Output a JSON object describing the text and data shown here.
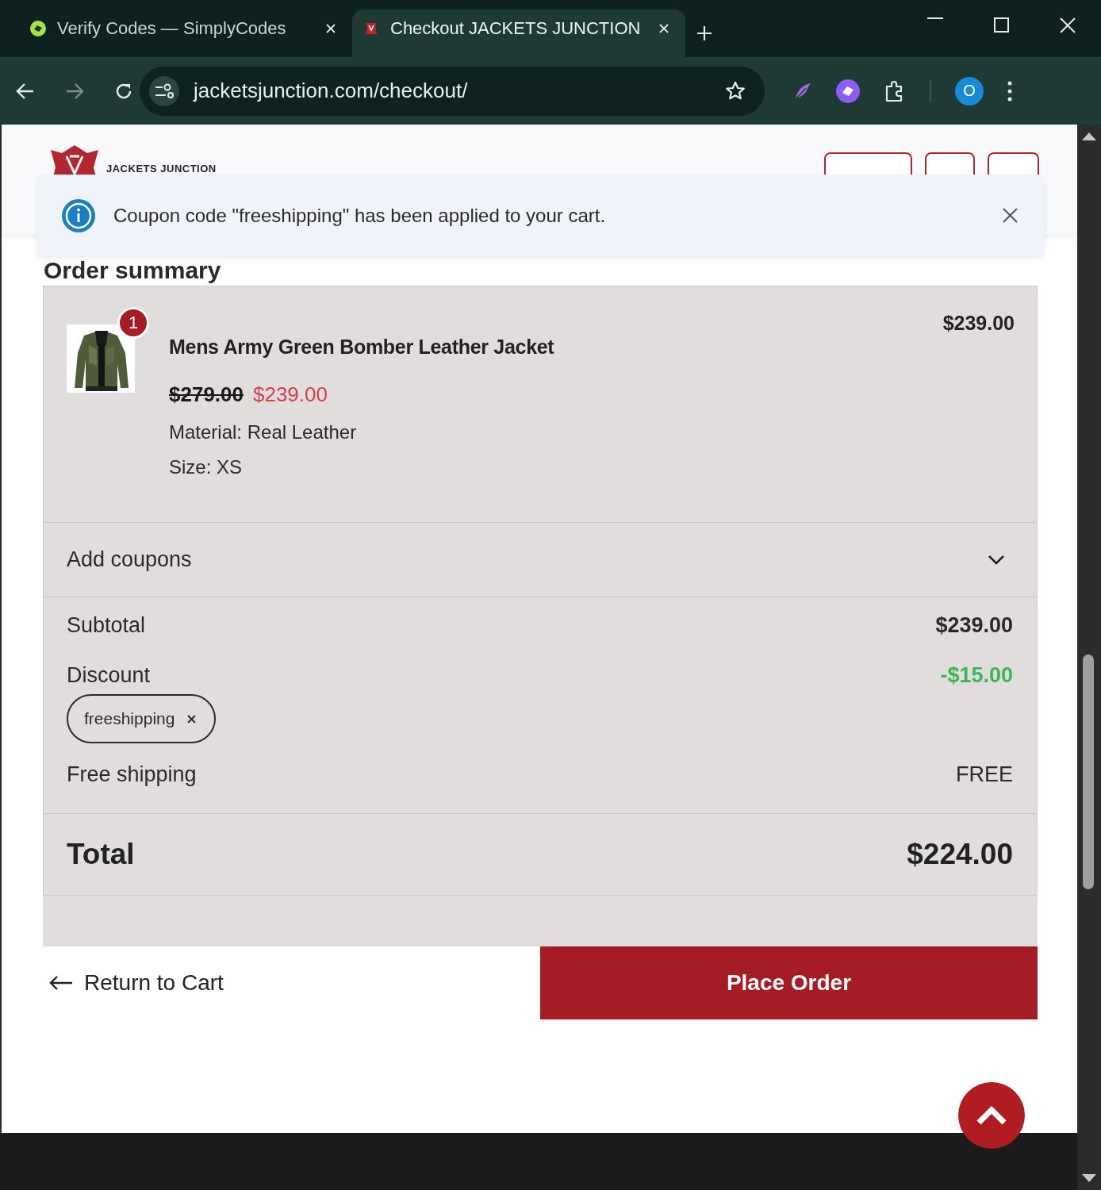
{
  "browser": {
    "tabs": [
      {
        "title": "Verify Codes — SimplyCodes",
        "selected": false
      },
      {
        "title": "Checkout JACKETS JUNCTION",
        "selected": true
      }
    ],
    "address": "jacketsjunction.com/checkout/",
    "profile_initial": "O"
  },
  "header": {
    "logo_text": "JACKETS JUNCTION"
  },
  "notice": {
    "message": "Coupon code \"freeshipping\" has been applied to your cart."
  },
  "order_summary": {
    "heading": "Order summary",
    "item": {
      "quantity": "1",
      "name": "Mens Army Green Bomber Leather Jacket",
      "original_price": "$279.00",
      "sale_price": "$239.00",
      "line_total": "$239.00",
      "attributes": [
        "Material: Real Leather",
        "Size: XS"
      ]
    },
    "coupons": {
      "label": "Add coupons",
      "expanded": false
    },
    "totals": [
      {
        "kind": "subtotal",
        "label": "Subtotal",
        "value": "$239.00"
      },
      {
        "kind": "discount",
        "label": "Discount",
        "value": "-$15.00",
        "coupon": "freeshipping"
      },
      {
        "kind": "shipping",
        "label": "Free shipping",
        "value": "FREE"
      }
    ],
    "total": {
      "label": "Total",
      "value": "$224.00"
    }
  },
  "actions": {
    "return": "Return to Cart",
    "place_order": "Place Order"
  }
}
